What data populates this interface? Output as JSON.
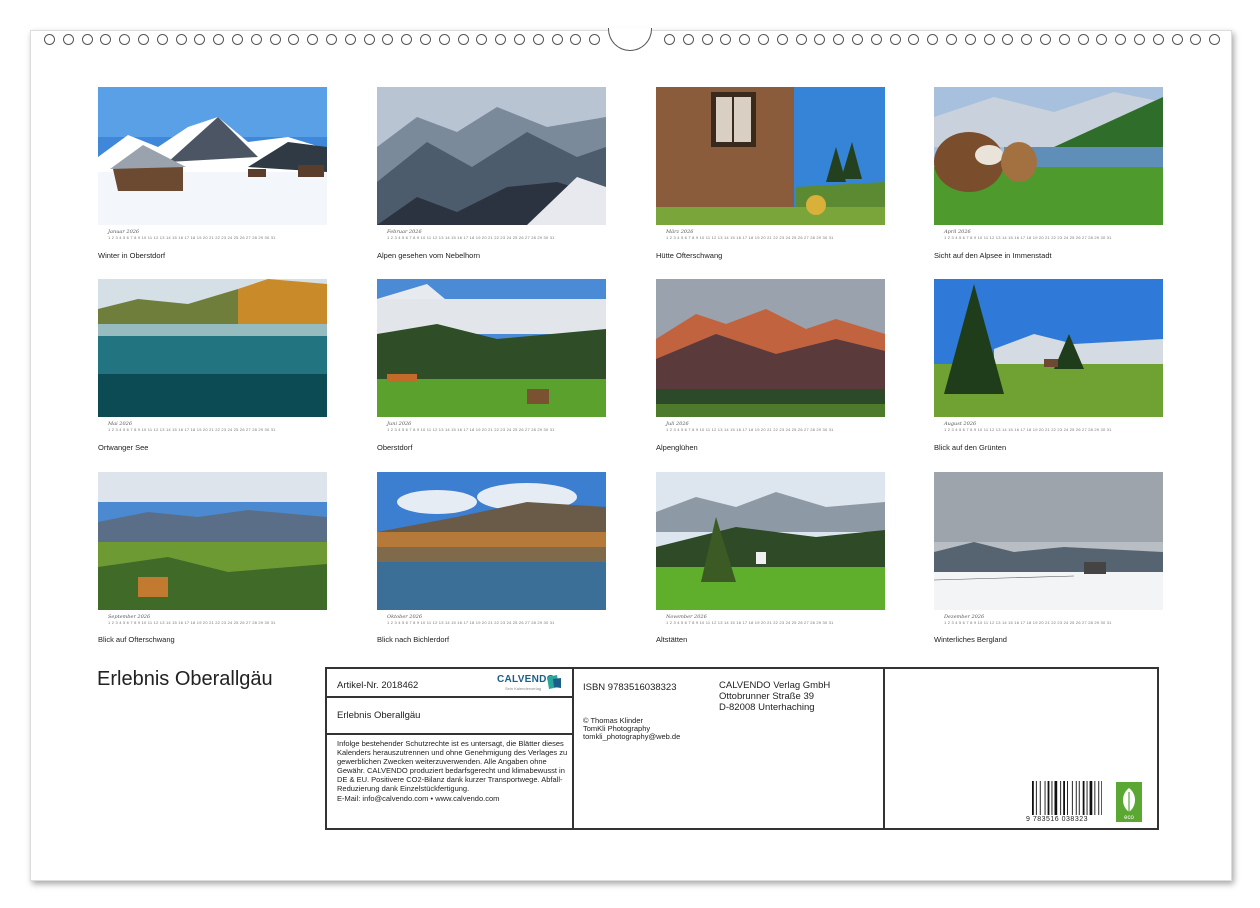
{
  "months": [
    {
      "month": "Januar 2026",
      "caption": "Winter in Oberstdorf"
    },
    {
      "month": "Februar 2026",
      "caption": "Alpen gesehen vom Nebelhorn"
    },
    {
      "month": "März 2026",
      "caption": "Hütte Ofterschwang"
    },
    {
      "month": "April 2026",
      "caption": "Sicht auf den Alpsee in Immenstadt"
    },
    {
      "month": "Mai 2026",
      "caption": "Ortwanger See"
    },
    {
      "month": "Juni 2026",
      "caption": "Oberstdorf"
    },
    {
      "month": "Juli 2026",
      "caption": "Alpenglühen"
    },
    {
      "month": "August 2026",
      "caption": "Blick auf den Grünten"
    },
    {
      "month": "September 2026",
      "caption": "Blick auf Ofterschwang"
    },
    {
      "month": "Oktober 2026",
      "caption": "Blick nach Bichlerdorf"
    },
    {
      "month": "November 2026",
      "caption": "Altstätten"
    },
    {
      "month": "Dezember 2026",
      "caption": "Winterliches Bergland"
    }
  ],
  "day_numbers": "1 2 3 4 5 6 7 8 9 10 11 12 13 14 15 16 17 18 19 20 21 22 23 24 25 26 27 28 29 30 31",
  "calendar_title": "Erlebnis Oberallgäu",
  "info": {
    "article_no": "Artikel-Nr. 2018462",
    "publisher_logo": "CALVENDO",
    "publisher_logo_sub": "Sein Kalenderverlag",
    "title": "Erlebnis Oberallgäu",
    "legal_text": "Infolge bestehender Schutzrechte ist es untersagt, die Blätter dieses Kalenders herauszutrennen und ohne Genehmigung des Verlages zu gewerblichen Zwecken weiterzuverwenden. Alle Angaben ohne Gewähr. CALVENDO produziert bedarfsgerecht und klimabewusst in DE & EU. Positivere CO2-Bilanz dank kurzer Transportwege. Abfall-Reduzierung dank Einzelstückfertigung.",
    "contact": "E-Mail: info@calvendo.com • www.calvendo.com",
    "isbn": "ISBN 9783516038323",
    "author_line1": "© Thomas Klinder",
    "author_line2": "TomKli Photography",
    "author_line3": "tomkli_photography@web.de",
    "publisher_line1": "CALVENDO Verlag GmbH",
    "publisher_line2": "Ottobrunner Straße 39",
    "publisher_line3": "D-82008 Unterhaching",
    "barcode_number": "9 783516 038323",
    "eco_label": "eco"
  }
}
